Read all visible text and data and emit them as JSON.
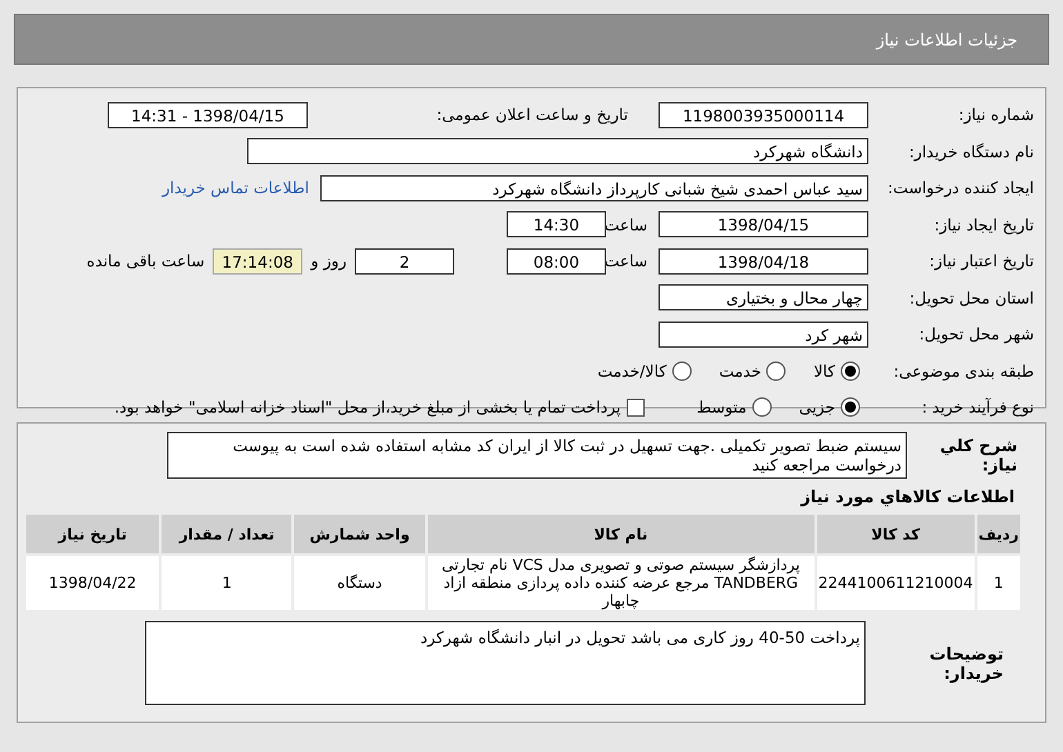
{
  "header": {
    "title": "جزئیات اطلاعات نیاز"
  },
  "details": {
    "need_number": {
      "label": "شماره نیاز:",
      "value": "1198003935000114"
    },
    "announce": {
      "label": "تاریخ و ساعت اعلان عمومی:",
      "value": "1398/04/15 - 14:31"
    },
    "buyer": {
      "label": "نام دستگاه خریدار:",
      "value": "دانشگاه شهرکرد"
    },
    "requester": {
      "label": "ایجاد کننده درخواست:",
      "value": "سید عباس احمدی شیخ شبانی کارپرداز دانشگاه شهرکرد",
      "link": "اطلاعات تماس خریدار"
    },
    "created": {
      "label": "تاریخ ایجاد نیاز:",
      "date": "1398/04/15",
      "time_label": "ساعت",
      "time": "14:30"
    },
    "validity": {
      "label": "تاریخ اعتبار نیاز:",
      "date": "1398/04/18",
      "time_label": "ساعت",
      "time": "08:00",
      "days": "2",
      "days_label": "روز و",
      "remaining": "17:14:08",
      "remaining_label": "ساعت باقی مانده"
    },
    "province": {
      "label": "استان محل تحویل:",
      "value": "چهار محال و بختیاری"
    },
    "city": {
      "label": "شهر محل تحویل:",
      "value": "شهر کرد"
    },
    "category": {
      "label": "طبقه بندی موضوعی:",
      "options": [
        {
          "label": "کالا",
          "selected": true
        },
        {
          "label": "خدمت",
          "selected": false
        },
        {
          "label": "کالا/خدمت",
          "selected": false
        }
      ]
    },
    "process": {
      "label": "نوع فرآیند خرید :",
      "options": [
        {
          "label": "جزیی",
          "selected": true
        },
        {
          "label": "متوسط",
          "selected": false
        }
      ],
      "payment": {
        "label": "پرداخت تمام یا بخشی از مبلغ خرید،از محل \"اسناد خزانه اسلامی\" خواهد بود.",
        "checked": false
      }
    }
  },
  "summary": {
    "label": "شرح کلي نياز:",
    "text": "سیستم ضبط تصویر تکمیلی  .جهت تسهیل در ثبت کالا از ایران کد مشابه استفاده شده است به پیوست درخواست مراجعه کنید"
  },
  "items": {
    "title": "اطلاعات كالاهاي مورد نياز",
    "columns": [
      "ردیف",
      "کد کالا",
      "نام کالا",
      "واحد شمارش",
      "تعداد / مقدار",
      "تاریخ نیاز"
    ],
    "rows": [
      [
        "1",
        "2244100611210004",
        "پردازشگر سیستم صوتی و تصویری مدل VCS نام تجارتی TANDBERG مرجع عرضه کننده داده پردازی منطقه ازاد چابهار",
        "دستگاه",
        "1",
        "1398/04/22"
      ]
    ]
  },
  "buyer_notes": {
    "label": "توضیحات خریدار:",
    "text": "پرداخت 50-40 روز کاری می باشد تحویل در انبار دانشگاه شهرکرد"
  }
}
